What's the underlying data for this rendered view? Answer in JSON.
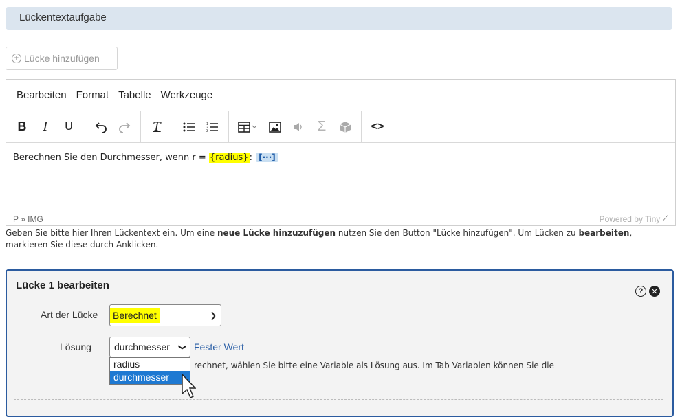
{
  "section": {
    "title": "Lückentextaufgabe"
  },
  "add_gap_button": {
    "label": "Lücke hinzufügen"
  },
  "editor": {
    "menu": [
      "Bearbeiten",
      "Format",
      "Tabelle",
      "Werkzeuge"
    ],
    "content": {
      "text_before": "Berechnen Sie den Durchmesser, wenn r = ",
      "variable": "{radius}",
      "after_variable": ": ",
      "gap_placeholder": "[···]"
    },
    "statusbar": {
      "path": "P » IMG",
      "powered": "Powered by Tiny"
    }
  },
  "help": {
    "part1": "Geben Sie bitte hier Ihren Lückentext ein. Um eine ",
    "bold1": "neue Lücke hinzuzufügen",
    "part2": " nutzen Sie den Button \"Lücke hinzufügen\". Um Lücken zu ",
    "bold2": "bearbeiten",
    "part3": ",",
    "line2": "markieren Sie diese durch Anklicken."
  },
  "gap_editor": {
    "title": "Lücke 1 bearbeiten",
    "type_label": "Art der Lücke",
    "type_value": "Berechnet",
    "solution_label": "Lösung",
    "solution_value": "durchmesser",
    "fixed_value_link": "Fester Wert",
    "dropdown_options": [
      "radius",
      "durchmesser"
    ],
    "selected_option": "durchmesser",
    "info_text": "rechnet, wählen Sie bitte eine Variable als Lösung aus. Im Tab Variablen können Sie die"
  }
}
